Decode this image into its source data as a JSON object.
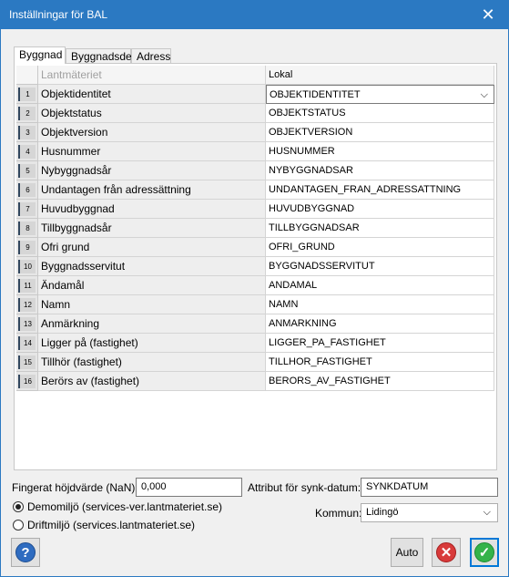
{
  "window": {
    "title": "Inställningar för BAL",
    "close_glyph": "✕"
  },
  "tabs": [
    {
      "label": "Byggnad",
      "active": true
    },
    {
      "label": "Byggnadsdel",
      "active": false
    },
    {
      "label": "Adress",
      "active": false
    }
  ],
  "grid": {
    "headers": [
      "Lantmäteriet",
      "Lokal"
    ],
    "rows": [
      {
        "num": "1",
        "name": "Objektidentitet",
        "value": "OBJEKTIDENTITET"
      },
      {
        "num": "2",
        "name": "Objektstatus",
        "value": "OBJEKTSTATUS"
      },
      {
        "num": "3",
        "name": "Objektversion",
        "value": "OBJEKTVERSION"
      },
      {
        "num": "4",
        "name": "Husnummer",
        "value": "HUSNUMMER"
      },
      {
        "num": "5",
        "name": "Nybyggnadsår",
        "value": "NYBYGGNADSAR"
      },
      {
        "num": "6",
        "name": "Undantagen från adressättning",
        "value": "UNDANTAGEN_FRAN_ADRESSATTNING"
      },
      {
        "num": "7",
        "name": "Huvudbyggnad",
        "value": "HUVUDBYGGNAD"
      },
      {
        "num": "8",
        "name": "Tillbyggnadsår",
        "value": "TILLBYGGNADSAR"
      },
      {
        "num": "9",
        "name": "Ofri grund",
        "value": "OFRI_GRUND"
      },
      {
        "num": "10",
        "name": "Byggnadsservitut",
        "value": "BYGGNADSSERVITUT"
      },
      {
        "num": "11",
        "name": "Ändamål",
        "value": "ANDAMAL"
      },
      {
        "num": "12",
        "name": "Namn",
        "value": "NAMN"
      },
      {
        "num": "13",
        "name": "Anmärkning",
        "value": "ANMARKNING"
      },
      {
        "num": "14",
        "name": "Ligger på (fastighet)",
        "value": "LIGGER_PA_FASTIGHET"
      },
      {
        "num": "15",
        "name": "Tillhör (fastighet)",
        "value": "TILLHOR_FASTIGHET"
      },
      {
        "num": "16",
        "name": "Berörs av (fastighet)",
        "value": "BERORS_AV_FASTIGHET"
      }
    ]
  },
  "form": {
    "fingerat_label": "Fingerat höjdvärde (NaN):",
    "fingerat_value": "0,000",
    "synk_label": "Attribut för synk-datum:",
    "synk_value": "SYNKDATUM",
    "demo_label": "Demomiljö (services-ver.lantmateriet.se)",
    "drift_label": "Driftmiljö (services.lantmateriet.se)",
    "kommun_label": "Kommun:",
    "kommun_value": "Lidingö",
    "selected_env": "demo"
  },
  "buttons": {
    "help_glyph": "?",
    "auto_label": "Auto",
    "cancel_glyph": "✕",
    "ok_glyph": "✓"
  },
  "icons": {
    "chevron": "⌵"
  }
}
